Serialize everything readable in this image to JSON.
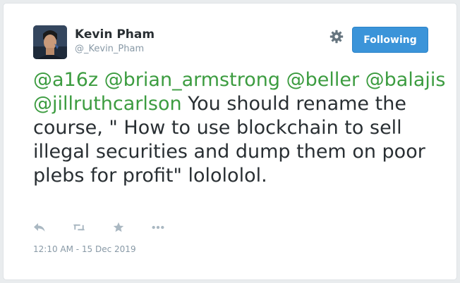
{
  "user": {
    "display_name": "Kevin Pham",
    "handle": "@_Kevin_Pham"
  },
  "follow_button": {
    "label": "Following"
  },
  "tweet": {
    "mentions": [
      "@a16z",
      "@brian_armstrong",
      "@beller",
      "@balajis",
      "@jillruthcarlson"
    ],
    "body": "You should rename the course, \" How to use blockchain to sell illegal securities and dump them on poor plebs for profit\" lolololol."
  },
  "actions": [
    {
      "icon": "reply-icon"
    },
    {
      "icon": "retweet-icon"
    },
    {
      "icon": "like-star-icon"
    },
    {
      "icon": "more-options-icon"
    }
  ],
  "timestamp": "12:10 AM - 15 Dec 2019",
  "colors": {
    "mention": "#3c9c40",
    "text": "#292f33",
    "muted": "#8899a6",
    "button_bg": "#3b94d9",
    "action_icon": "#aab8c2"
  }
}
